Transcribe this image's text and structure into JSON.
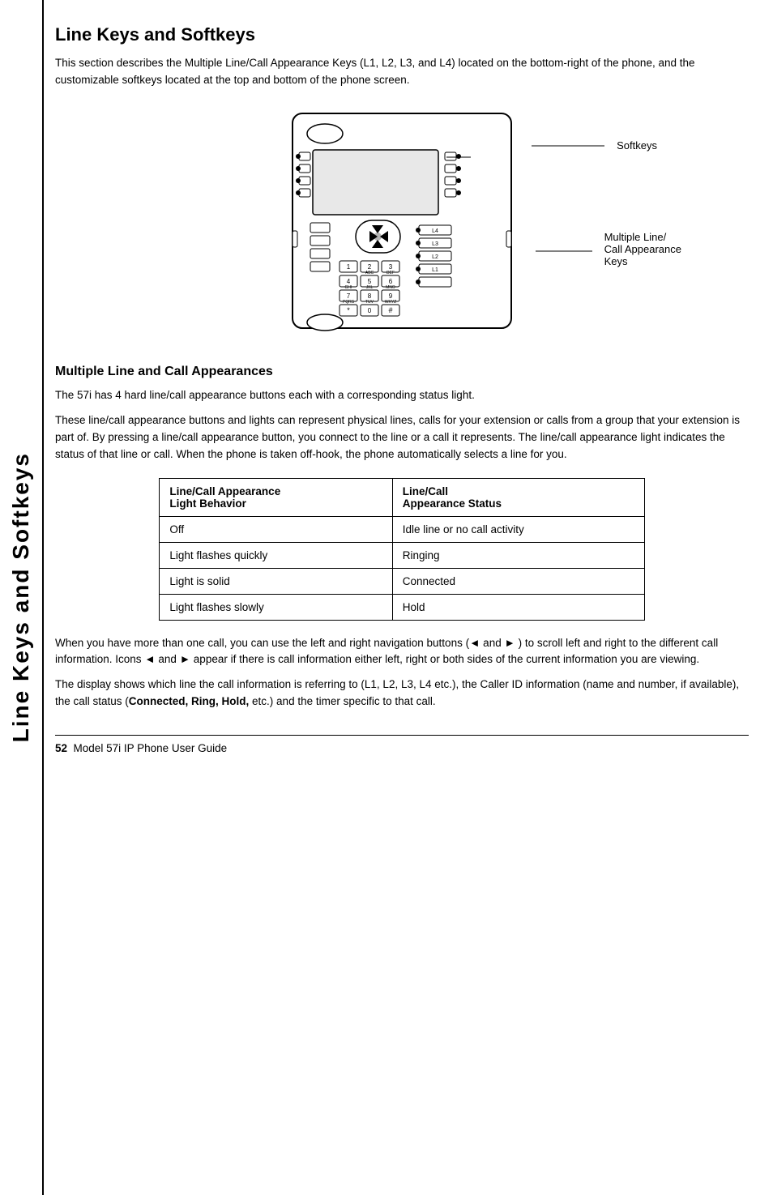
{
  "sidebar": {
    "text": "Line Keys and Softkeys"
  },
  "page_title": "Line Keys and Softkeys",
  "intro_text": "This section describes the Multiple Line/Call Appearance Keys (L1, L2, L3, and L4) located on the bottom-right of the phone, and the customizable softkeys located at the top and bottom of the phone screen.",
  "diagram": {
    "label_softkeys": "Softkeys",
    "label_multiple_line": "Multiple Line/",
    "label_call_appearance": "Call Appearance",
    "label_keys": "Keys"
  },
  "section_heading": "Multiple Line and Call Appearances",
  "para1": "The 57i has 4 hard line/call appearance buttons each with a corresponding status light.",
  "para2": "These line/call appearance buttons and lights can represent physical lines, calls for your extension or calls from a group that your extension is part of. By pressing a line/call appearance button, you connect to the line or a call it represents. The line/call appearance light indicates the status of that line or call. When the phone is taken off-hook, the phone automatically selects a line for you.",
  "table": {
    "col1_header": "Line/Call Appearance\nLight Behavior",
    "col2_header": "Line/Call\nAppearance Status",
    "rows": [
      {
        "col1": "Off",
        "col2": "Idle line or no call activity"
      },
      {
        "col1": "Light flashes quickly",
        "col2": "Ringing"
      },
      {
        "col1": "Light is solid",
        "col2": "Connected"
      },
      {
        "col1": "Light flashes slowly",
        "col2": "Hold"
      }
    ]
  },
  "para3": "When you have more than one call, you can use the left and right navigation buttons (◄ and ► ) to scroll left and right to the different call information. Icons ◄ and ► appear if there is call information either left, right or both sides of the current information you are viewing.",
  "para4_part1": "The display shows which line the call information is referring to (L1, L2, L3, L4 etc.), the Caller ID information (name and number, if available), the call status (",
  "para4_bold": "Connected, Ring, Hold,",
  "para4_part2": " etc.) and the timer specific to that call.",
  "footer": {
    "page_number": "52",
    "guide_title": "Model 57i IP Phone User Guide"
  }
}
